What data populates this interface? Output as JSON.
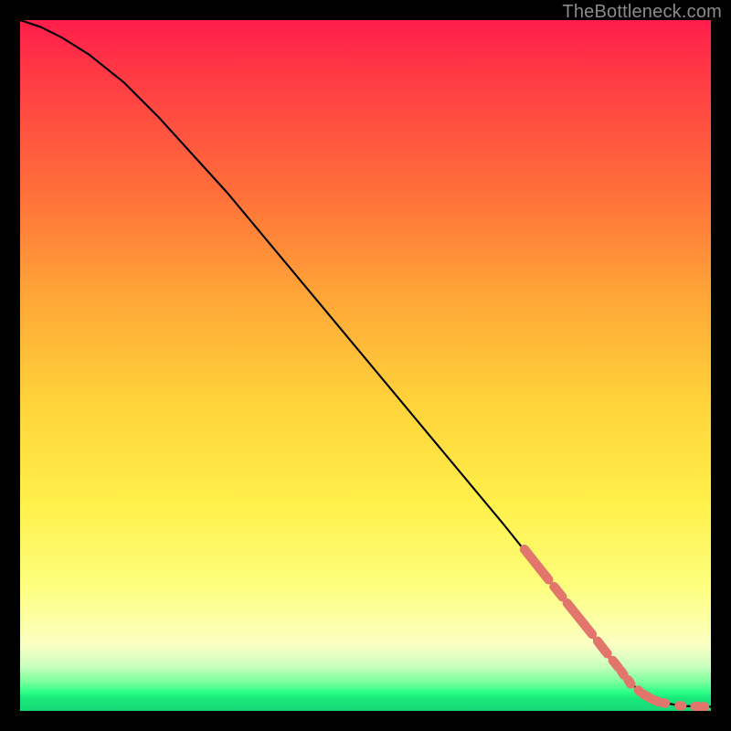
{
  "attribution": "TheBottleneck.com",
  "chart_data": {
    "type": "line",
    "title": "",
    "xlabel": "",
    "ylabel": "",
    "xlim": [
      0,
      100
    ],
    "ylim": [
      0,
      100
    ],
    "grid": false,
    "series": [
      {
        "name": "curve",
        "x": [
          0,
          3,
          6,
          10,
          15,
          20,
          30,
          40,
          50,
          60,
          70,
          78,
          85,
          88,
          90,
          93,
          96,
          100
        ],
        "y": [
          100,
          99,
          97.5,
          95,
          91,
          86,
          75,
          63,
          51,
          39,
          27,
          17,
          8,
          4.5,
          2.5,
          1.2,
          0.7,
          0.6
        ]
      }
    ],
    "dashed_segments": [
      {
        "x": [
          73.0,
          76.5
        ],
        "y": [
          23.4,
          19.0
        ]
      },
      {
        "x": [
          77.3,
          78.5
        ],
        "y": [
          18.0,
          16.5
        ]
      },
      {
        "x": [
          79.2,
          82.8
        ],
        "y": [
          15.6,
          11.1
        ]
      },
      {
        "x": [
          83.6,
          84.2
        ],
        "y": [
          10.1,
          9.3
        ]
      },
      {
        "x": [
          84.2,
          85.0
        ],
        "y": [
          9.3,
          8.3
        ]
      },
      {
        "x": [
          85.8,
          86.6
        ],
        "y": [
          7.3,
          6.3
        ]
      },
      {
        "x": [
          87.0,
          87.4
        ],
        "y": [
          5.8,
          5.2
        ]
      },
      {
        "x": [
          88.0,
          88.4
        ],
        "y": [
          4.5,
          3.9
        ]
      },
      {
        "x": [
          89.5,
          89.7
        ],
        "y": [
          3.0,
          2.8
        ]
      },
      {
        "x": [
          90.1,
          91.3
        ],
        "y": [
          2.5,
          1.8
        ]
      },
      {
        "x": [
          91.7,
          92.5
        ],
        "y": [
          1.6,
          1.3
        ]
      },
      {
        "x": [
          93.0,
          93.4
        ],
        "y": [
          1.2,
          1.1
        ]
      },
      {
        "x": [
          95.4,
          95.8
        ],
        "y": [
          0.75,
          0.73
        ]
      },
      {
        "x": [
          97.7,
          98.2
        ],
        "y": [
          0.65,
          0.63
        ]
      },
      {
        "x": [
          98.7,
          99.1
        ],
        "y": [
          0.62,
          0.61
        ]
      }
    ],
    "colors": {
      "curve": "#000000",
      "dash": "#e2766d",
      "gradient_top": "#ff1d4b",
      "gradient_mid": "#fff04a",
      "gradient_bottom": "#17d877"
    }
  }
}
